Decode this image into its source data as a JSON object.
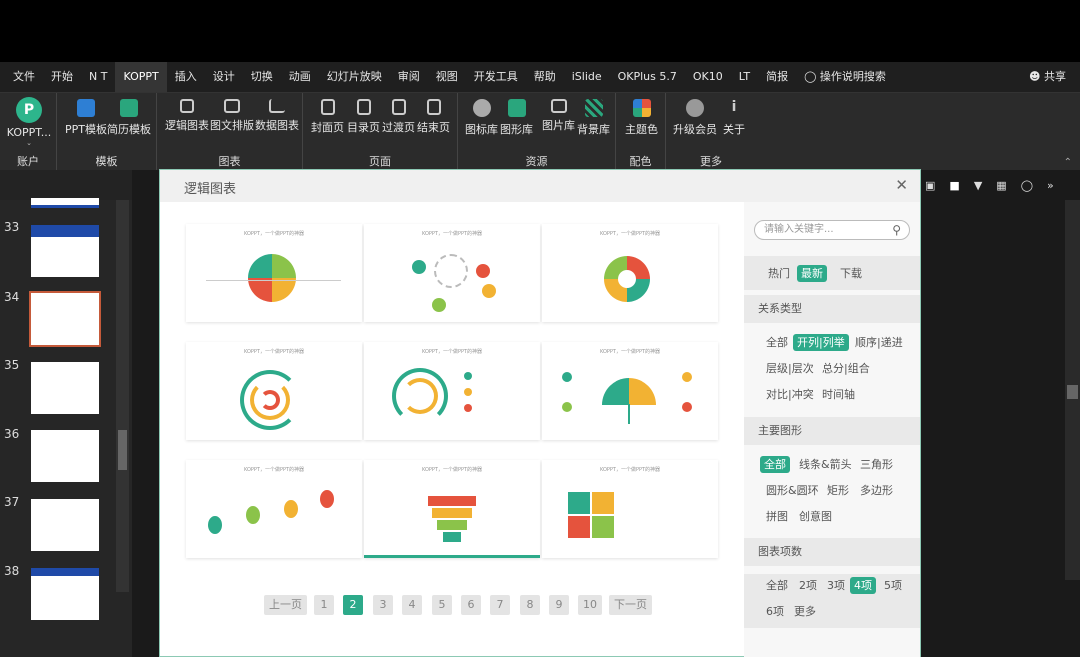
{
  "menubar": {
    "items": [
      "文件",
      "开始",
      "N T",
      "KOPPT",
      "插入",
      "设计",
      "切换",
      "动画",
      "幻灯片放映",
      "审阅",
      "视图",
      "开发工具",
      "帮助",
      "iSlide",
      "OKPlus 5.7",
      "OK10",
      "LT",
      "简报"
    ],
    "active_index": 3,
    "tell_me": "操作说明搜索",
    "share": "共享"
  },
  "ribbon": {
    "account": {
      "label": "KOPPT...",
      "group": "账户"
    },
    "template": {
      "buttons": [
        "PPT模板",
        "简历模板"
      ],
      "group": "模板"
    },
    "chart": {
      "buttons": [
        "逻辑图表",
        "图文排版",
        "数据图表"
      ],
      "group": "图表"
    },
    "page": {
      "buttons": [
        "封面页",
        "目录页",
        "过渡页",
        "结束页"
      ],
      "group": "页面"
    },
    "resource": {
      "buttons": [
        "图标库",
        "图形库",
        "图片库",
        "背景库"
      ],
      "group": "资源"
    },
    "color": {
      "buttons": [
        "主题色"
      ],
      "group": "配色"
    },
    "more": {
      "buttons": [
        "升级会员",
        "关于"
      ],
      "group": "更多"
    }
  },
  "slides": [
    {
      "num": "33"
    },
    {
      "num": "34"
    },
    {
      "num": "35"
    },
    {
      "num": "36"
    },
    {
      "num": "37"
    },
    {
      "num": "38"
    }
  ],
  "dialog": {
    "title": "逻辑图表",
    "card_caption": "KOPPT，一个做PPT的神器",
    "pagination": {
      "prev": "上一页",
      "pages": [
        "1",
        "2",
        "3",
        "4",
        "5",
        "6",
        "7",
        "8",
        "9",
        "10"
      ],
      "current": "2",
      "next": "下一页"
    },
    "side": {
      "search_placeholder": "请输入关键字...",
      "sort": [
        "热门",
        "最新",
        "下载"
      ],
      "sort_active": "最新",
      "relation_header": "关系类型",
      "relation": [
        "全部",
        "开列|列举",
        "顺序|递进",
        "层级|层次",
        "总分|组合",
        "对比|冲突",
        "时间轴"
      ],
      "relation_active": "开列|列举",
      "shape_header": "主要图形",
      "shape": [
        "全部",
        "线条&箭头",
        "三角形",
        "圆形&圆环",
        "矩形",
        "多边形",
        "拼图",
        "创意图"
      ],
      "shape_active": "全部",
      "count_header": "图表项数",
      "count": [
        "全部",
        "2项",
        "3项",
        "4项",
        "5项",
        "6项",
        "更多"
      ],
      "count_active": "4项"
    }
  },
  "colors": {
    "accent": "#2daa8a",
    "menubar": "#1f1f1f",
    "ribbon": "#2b2b2b"
  }
}
